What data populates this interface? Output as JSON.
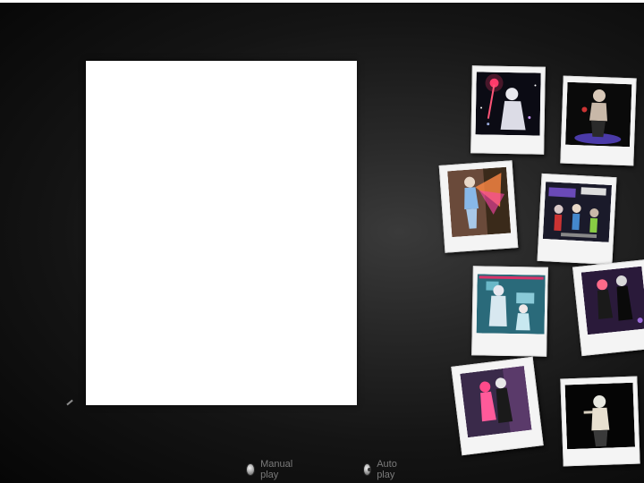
{
  "photo_viewer": {
    "main_photo": "blank",
    "thumbnails": [
      {
        "icon": "thumbnail-character-sword"
      },
      {
        "icon": "thumbnail-character-dark"
      },
      {
        "icon": "thumbnail-character-wings"
      },
      {
        "icon": "thumbnail-group-scene"
      },
      {
        "icon": "thumbnail-two-characters-blue"
      },
      {
        "icon": "thumbnail-couple-purple"
      },
      {
        "icon": "thumbnail-couple-pink"
      },
      {
        "icon": "thumbnail-single-character"
      }
    ]
  },
  "playback": {
    "manual_label": "Manual play",
    "auto_label": "Auto play",
    "selected": "Auto play"
  }
}
